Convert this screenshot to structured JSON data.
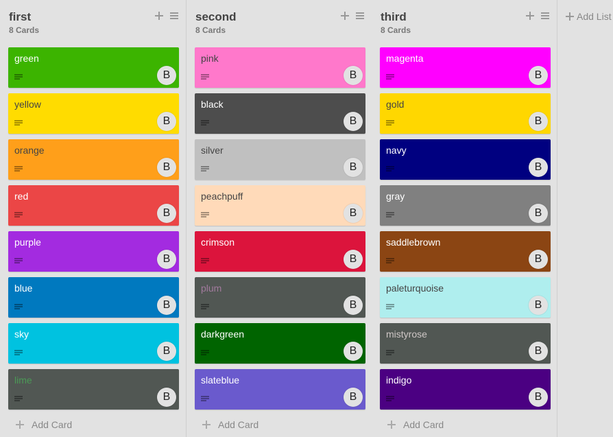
{
  "lists": [
    {
      "title": "first",
      "count": "8 Cards",
      "add_card_label": "Add Card",
      "cards": [
        {
          "title": "green",
          "bg": "#3cb400",
          "fg": "#ffffff",
          "avatar": "B"
        },
        {
          "title": "yellow",
          "bg": "#ffdc00",
          "fg": "#444444",
          "avatar": "B"
        },
        {
          "title": "orange",
          "bg": "#ff9f1a",
          "fg": "#444444",
          "avatar": "B"
        },
        {
          "title": "red",
          "bg": "#eb4646",
          "fg": "#ffffff",
          "avatar": "B"
        },
        {
          "title": "purple",
          "bg": "#a32be0",
          "fg": "#ffffff",
          "avatar": "B"
        },
        {
          "title": "blue",
          "bg": "#0079bf",
          "fg": "#ffffff",
          "avatar": "B"
        },
        {
          "title": "sky",
          "bg": "#00c2e0",
          "fg": "#ffffff",
          "avatar": "B"
        },
        {
          "title": "lime",
          "bg": "#515753",
          "fg": "#4b9a56",
          "avatar": "B"
        }
      ]
    },
    {
      "title": "second",
      "count": "8 Cards",
      "add_card_label": "Add Card",
      "cards": [
        {
          "title": "pink",
          "bg": "#ff78cb",
          "fg": "#444444",
          "avatar": "B"
        },
        {
          "title": "black",
          "bg": "#4d4d4d",
          "fg": "#ffffff",
          "avatar": "B"
        },
        {
          "title": "silver",
          "bg": "#c0c0c0",
          "fg": "#444444",
          "avatar": "B"
        },
        {
          "title": "peachpuff",
          "bg": "#ffdab9",
          "fg": "#444444",
          "avatar": "B"
        },
        {
          "title": "crimson",
          "bg": "#dc143c",
          "fg": "#ffffff",
          "avatar": "B"
        },
        {
          "title": "plum",
          "bg": "#515753",
          "fg": "#a27a9d",
          "avatar": "B"
        },
        {
          "title": "darkgreen",
          "bg": "#006400",
          "fg": "#ffffff",
          "avatar": "B"
        },
        {
          "title": "slateblue",
          "bg": "#6a5acd",
          "fg": "#ffffff",
          "avatar": "B"
        }
      ]
    },
    {
      "title": "third",
      "count": "8 Cards",
      "add_card_label": "Add Card",
      "cards": [
        {
          "title": "magenta",
          "bg": "#ff00ff",
          "fg": "#ffffff",
          "avatar": "B"
        },
        {
          "title": "gold",
          "bg": "#ffd700",
          "fg": "#444444",
          "avatar": "B"
        },
        {
          "title": "navy",
          "bg": "#000080",
          "fg": "#ffffff",
          "avatar": "B"
        },
        {
          "title": "gray",
          "bg": "#808080",
          "fg": "#ffffff",
          "avatar": "B"
        },
        {
          "title": "saddlebrown",
          "bg": "#8b4513",
          "fg": "#ffffff",
          "avatar": "B"
        },
        {
          "title": "paleturquoise",
          "bg": "#afeeee",
          "fg": "#444444",
          "avatar": "B"
        },
        {
          "title": "mistyrose",
          "bg": "#515753",
          "fg": "#cfc7c6",
          "avatar": "B"
        },
        {
          "title": "indigo",
          "bg": "#4b0082",
          "fg": "#ffffff",
          "avatar": "B"
        }
      ]
    }
  ],
  "add_list_label": "Add List"
}
